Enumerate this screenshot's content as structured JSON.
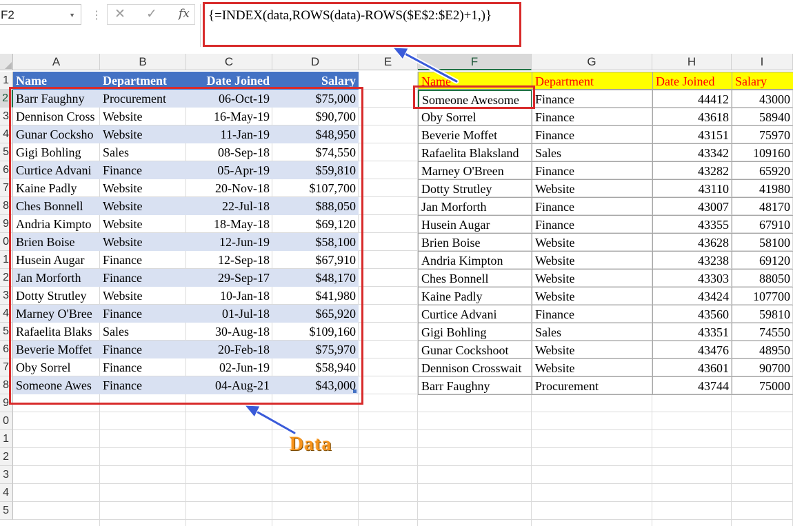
{
  "formula_bar": {
    "name_box": "F2",
    "cancel_icon": "cancel-x-icon",
    "enter_icon": "checkmark-icon",
    "fx_label": "fx",
    "formula": "{=INDEX(data,ROWS(data)-ROWS($E$2:$E2)+1,)}"
  },
  "columns": [
    "A",
    "B",
    "C",
    "D",
    "E",
    "F",
    "G",
    "H",
    "I"
  ],
  "rows": [
    "1",
    "2",
    "3",
    "4",
    "5",
    "6",
    "7",
    "8",
    "9",
    "0",
    "1",
    "2",
    "3",
    "4",
    "5",
    "6",
    "7",
    "8",
    "9",
    "0",
    "1",
    "2",
    "3",
    "4",
    "5"
  ],
  "left_table": {
    "headers": [
      "Name",
      "Department",
      "Date Joined",
      "Salary"
    ],
    "rows": [
      [
        "Barr Faughny",
        "Procurement",
        "06-Oct-19",
        "$75,000"
      ],
      [
        "Dennison Cross",
        "Website",
        "16-May-19",
        "$90,700"
      ],
      [
        "Gunar Cocksho",
        "Website",
        "11-Jan-19",
        "$48,950"
      ],
      [
        "Gigi Bohling",
        "Sales",
        "08-Sep-18",
        "$74,550"
      ],
      [
        "Curtice Advani",
        "Finance",
        "05-Apr-19",
        "$59,810"
      ],
      [
        "Kaine Padly",
        "Website",
        "20-Nov-18",
        "$107,700"
      ],
      [
        "Ches Bonnell",
        "Website",
        "22-Jul-18",
        "$88,050"
      ],
      [
        "Andria Kimpto",
        "Website",
        "18-May-18",
        "$69,120"
      ],
      [
        "Brien Boise",
        "Website",
        "12-Jun-19",
        "$58,100"
      ],
      [
        "Husein Augar",
        "Finance",
        "12-Sep-18",
        "$67,910"
      ],
      [
        "Jan Morforth",
        "Finance",
        "29-Sep-17",
        "$48,170"
      ],
      [
        "Dotty Strutley",
        "Website",
        "10-Jan-18",
        "$41,980"
      ],
      [
        "Marney O'Bree",
        "Finance",
        "01-Jul-18",
        "$65,920"
      ],
      [
        "Rafaelita Blaks",
        "Sales",
        "30-Aug-18",
        "$109,160"
      ],
      [
        "Beverie Moffet",
        "Finance",
        "20-Feb-18",
        "$75,970"
      ],
      [
        "Oby Sorrel",
        "Finance",
        "02-Jun-19",
        "$58,940"
      ],
      [
        "Someone Awes",
        "Finance",
        "04-Aug-21",
        "$43,000"
      ]
    ]
  },
  "right_table": {
    "headers": [
      "Name",
      "Department",
      "Date Joined",
      "Salary"
    ],
    "rows": [
      [
        "Someone Awesome",
        "Finance",
        "44412",
        "43000"
      ],
      [
        "Oby Sorrel",
        "Finance",
        "43618",
        "58940"
      ],
      [
        "Beverie Moffet",
        "Finance",
        "43151",
        "75970"
      ],
      [
        "Rafaelita Blaksland",
        "Sales",
        "43342",
        "109160"
      ],
      [
        "Marney O'Breen",
        "Finance",
        "43282",
        "65920"
      ],
      [
        "Dotty Strutley",
        "Website",
        "43110",
        "41980"
      ],
      [
        "Jan Morforth",
        "Finance",
        "43007",
        "48170"
      ],
      [
        "Husein Augar",
        "Finance",
        "43355",
        "67910"
      ],
      [
        "Brien Boise",
        "Website",
        "43628",
        "58100"
      ],
      [
        "Andria Kimpton",
        "Website",
        "43238",
        "69120"
      ],
      [
        "Ches Bonnell",
        "Website",
        "43303",
        "88050"
      ],
      [
        "Kaine Padly",
        "Website",
        "43424",
        "107700"
      ],
      [
        "Curtice Advani",
        "Finance",
        "43560",
        "59810"
      ],
      [
        "Gigi Bohling",
        "Sales",
        "43351",
        "74550"
      ],
      [
        "Gunar Cockshoot",
        "Website",
        "43476",
        "48950"
      ],
      [
        "Dennison Crosswait",
        "Website",
        "43601",
        "90700"
      ],
      [
        "Barr Faughny",
        "Procurement",
        "43744",
        "75000"
      ]
    ]
  },
  "annotation": {
    "label": "Data"
  },
  "colors": {
    "header_blue": "#4472c4",
    "band_blue": "#d9e1f2",
    "highlight_red": "#d82b2b",
    "yellow": "#ffff00",
    "arrow_blue": "#3a5bd9",
    "callout_orange": "#f7941d"
  }
}
